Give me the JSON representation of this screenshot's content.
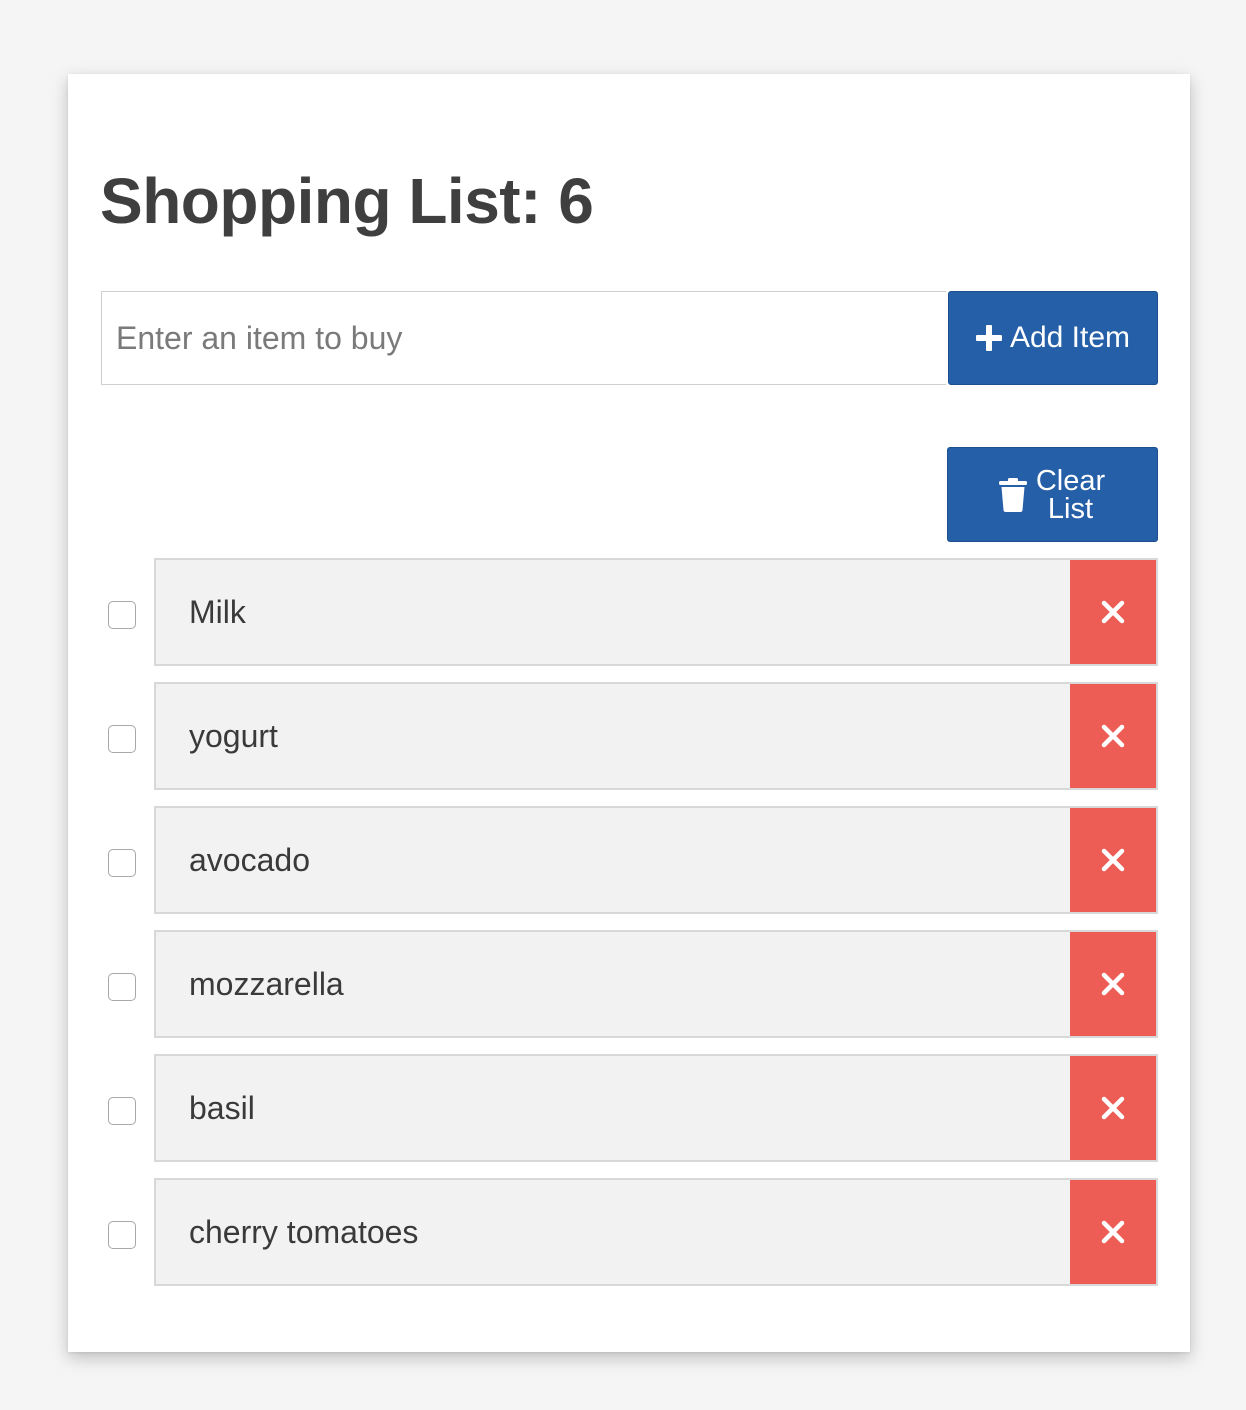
{
  "header": {
    "title": "Shopping List: 6",
    "count": 6
  },
  "form": {
    "input_placeholder": "Enter an item to buy",
    "input_value": "",
    "add_button_label": "Add Item",
    "add_button_icon": "plus-icon"
  },
  "clear_button": {
    "label": "Clear List",
    "icon": "trash-icon"
  },
  "items": [
    {
      "label": "Milk",
      "checked": false
    },
    {
      "label": "yogurt",
      "checked": false
    },
    {
      "label": "avocado",
      "checked": false
    },
    {
      "label": "mozzarella",
      "checked": false
    },
    {
      "label": "basil",
      "checked": false
    },
    {
      "label": "cherry tomatoes",
      "checked": false
    }
  ],
  "colors": {
    "primary": "#245fa8",
    "danger": "#ed5d56",
    "item_bg": "#f2f2f2",
    "page_bg": "#f5f5f5"
  }
}
